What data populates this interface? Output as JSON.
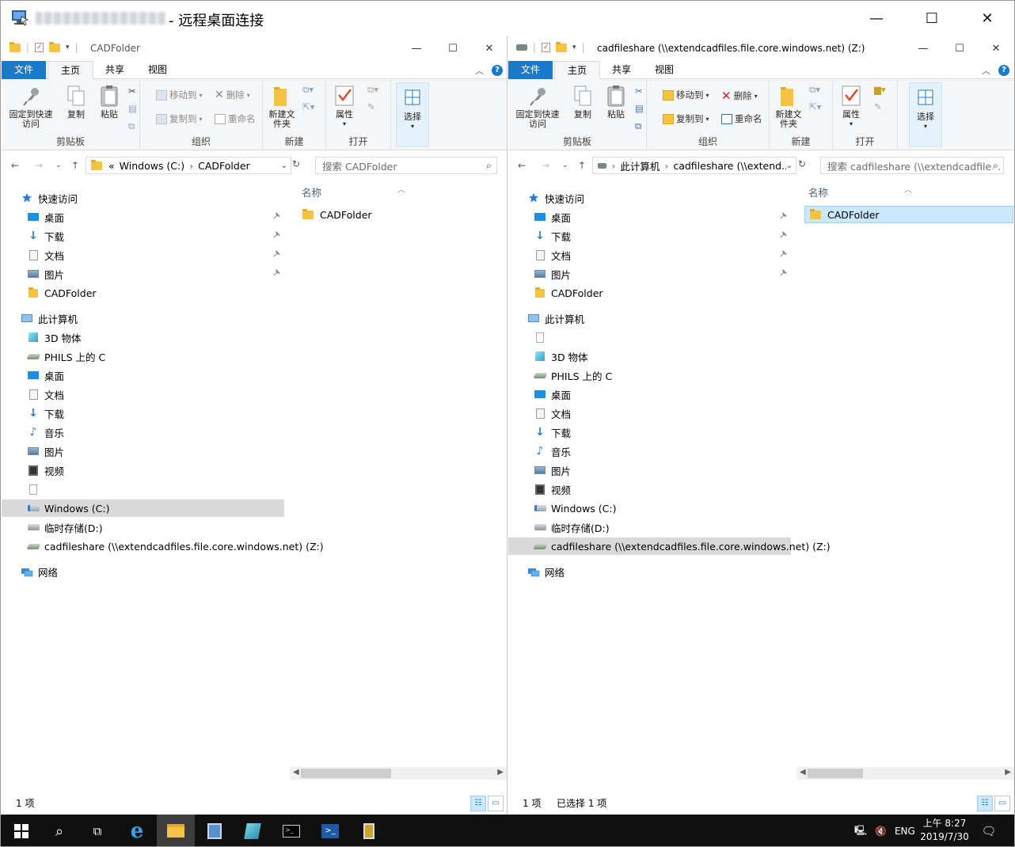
{
  "rdp": {
    "title": "- 远程桌面连接",
    "minimize": "—",
    "maximize": "☐",
    "close": "✕"
  },
  "left": {
    "title": "CADFolder",
    "menu": {
      "file": "文件",
      "home": "主页",
      "share": "共享",
      "view": "视图"
    },
    "ribbon": {
      "clipboard": {
        "pin": "固定到快速访问",
        "copy": "复制",
        "paste": "粘贴",
        "label": "剪贴板"
      },
      "organize": {
        "move": "移动到",
        "copyto": "复制到",
        "delete": "删除",
        "rename": "重命名",
        "label": "组织"
      },
      "new": {
        "newfolder": "新建文件夹",
        "label": "新建"
      },
      "open": {
        "props": "属性",
        "label": "打开"
      },
      "select": {
        "select": "选择"
      }
    },
    "address": {
      "prefix": "«",
      "parts": [
        "Windows (C:)",
        "CADFolder"
      ]
    },
    "search": {
      "placeholder": "搜索 CADFolder"
    },
    "tree": [
      {
        "label": "快速访问",
        "icon": "star",
        "indent": 0,
        "pin": false
      },
      {
        "label": "桌面",
        "icon": "desktop",
        "indent": 1,
        "pin": true
      },
      {
        "label": "下载",
        "icon": "download",
        "indent": 1,
        "pin": true
      },
      {
        "label": "文档",
        "icon": "doc",
        "indent": 1,
        "pin": true
      },
      {
        "label": "图片",
        "icon": "pic",
        "indent": 1,
        "pin": true
      },
      {
        "label": "CADFolder",
        "icon": "folder",
        "indent": 1,
        "pin": false
      },
      {
        "label": "此计算机",
        "icon": "pc",
        "indent": 0,
        "pin": false,
        "gap": true
      },
      {
        "label": "3D 物体",
        "icon": "cube",
        "indent": 1
      },
      {
        "label": "PHILS 上的 C",
        "icon": "netdrive",
        "indent": 1
      },
      {
        "label": "桌面",
        "icon": "desktop",
        "indent": 1
      },
      {
        "label": "文档",
        "icon": "doc",
        "indent": 1
      },
      {
        "label": "下载",
        "icon": "download",
        "indent": 1
      },
      {
        "label": "音乐",
        "icon": "music",
        "indent": 1
      },
      {
        "label": "图片",
        "icon": "pic",
        "indent": 1
      },
      {
        "label": "视频",
        "icon": "video",
        "indent": 1
      },
      {
        "label": "",
        "icon": "blank",
        "indent": 1
      },
      {
        "label": "Windows (C:)",
        "icon": "drive",
        "indent": 1,
        "sel": true
      },
      {
        "label": "临时存储(D:)",
        "icon": "drive2",
        "indent": 1
      },
      {
        "label": "cadfileshare (\\\\extendcadfiles.file.core.windows.net) (Z:)",
        "icon": "netdrive",
        "indent": 1
      },
      {
        "label": "网络",
        "icon": "network",
        "indent": 0,
        "gap": true
      }
    ],
    "col": {
      "name": "名称"
    },
    "files": [
      {
        "name": "CADFolder",
        "sel": false
      }
    ],
    "status": {
      "count": "1 项",
      "selected": ""
    }
  },
  "right": {
    "title": "cadfileshare (\\\\extendcadfiles.file.core.windows.net) (Z:)",
    "menu": {
      "file": "文件",
      "home": "主页",
      "share": "共享",
      "view": "视图"
    },
    "ribbon": {
      "clipboard": {
        "pin": "固定到快速访问",
        "copy": "复制",
        "paste": "粘贴",
        "label": "剪贴板"
      },
      "organize": {
        "move": "移动到",
        "copyto": "复制到",
        "delete": "删除",
        "rename": "重命名",
        "label": "组织"
      },
      "new": {
        "newfolder": "新建文件夹",
        "label": "新建"
      },
      "open": {
        "props": "属性",
        "label": "打开"
      },
      "select": {
        "select": "选择"
      }
    },
    "address": {
      "prefix": "",
      "parts": [
        "此计算机",
        "cadfileshare (\\\\extend..."
      ]
    },
    "search": {
      "placeholder": "搜索 cadfileshare (\\\\extendcadfile..."
    },
    "tree": [
      {
        "label": "快速访问",
        "icon": "star",
        "indent": 0
      },
      {
        "label": "桌面",
        "icon": "desktop",
        "indent": 1,
        "pin": true
      },
      {
        "label": "下载",
        "icon": "download",
        "indent": 1,
        "pin": true
      },
      {
        "label": "文档",
        "icon": "doc",
        "indent": 1,
        "pin": true
      },
      {
        "label": "图片",
        "icon": "pic",
        "indent": 1,
        "pin": true
      },
      {
        "label": "CADFolder",
        "icon": "folder",
        "indent": 1
      },
      {
        "label": "此计算机",
        "icon": "pc",
        "indent": 0,
        "gap": true
      },
      {
        "label": "",
        "icon": "blank",
        "indent": 1
      },
      {
        "label": "3D 物体",
        "icon": "cube",
        "indent": 1
      },
      {
        "label": "PHILS 上的 C",
        "icon": "netdrive",
        "indent": 1
      },
      {
        "label": "桌面",
        "icon": "desktop",
        "indent": 1
      },
      {
        "label": "文档",
        "icon": "doc",
        "indent": 1
      },
      {
        "label": "下载",
        "icon": "download",
        "indent": 1
      },
      {
        "label": "音乐",
        "icon": "music",
        "indent": 1
      },
      {
        "label": "图片",
        "icon": "pic",
        "indent": 1
      },
      {
        "label": "视频",
        "icon": "video",
        "indent": 1
      },
      {
        "label": "Windows (C:)",
        "icon": "drive",
        "indent": 1
      },
      {
        "label": "临时存储(D:)",
        "icon": "drive2",
        "indent": 1
      },
      {
        "label": "cadfileshare (\\\\extendcadfiles.file.core.windows.net) (Z:)",
        "icon": "netdrive",
        "indent": 1,
        "sel": true
      },
      {
        "label": "网络",
        "icon": "network",
        "indent": 0,
        "gap": true
      }
    ],
    "col": {
      "name": "名称"
    },
    "files": [
      {
        "name": "CADFolder",
        "sel": true
      }
    ],
    "status": {
      "count": "1 项",
      "selected": "已选择 1 项"
    }
  },
  "taskbar": {
    "lang": "ENG",
    "time": "上午 8:27",
    "date": "2019/7/30"
  },
  "colors": {
    "accent": "#1979ca",
    "selection": "#cce8ff",
    "taskbar": "#101010"
  }
}
